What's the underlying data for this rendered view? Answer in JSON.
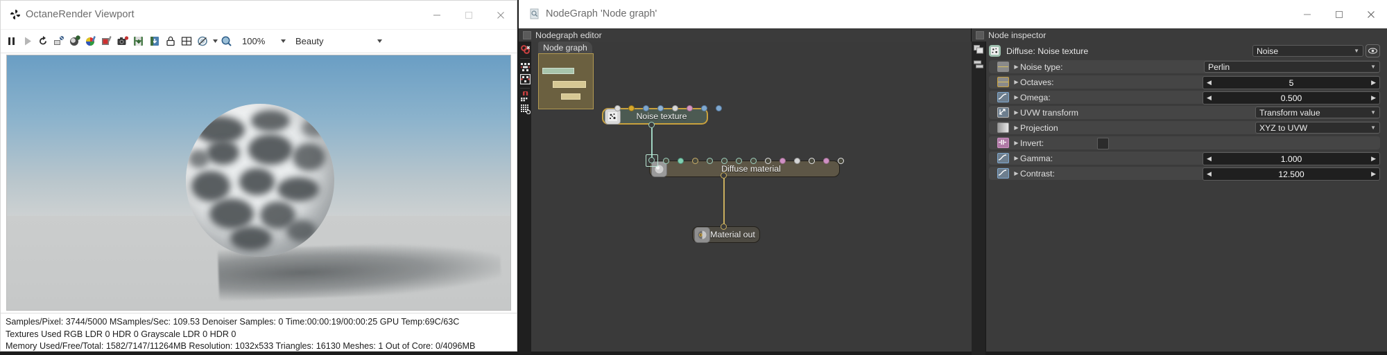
{
  "viewport_window": {
    "title": "OctaneRender Viewport",
    "app_icon": "octane-fan-icon",
    "window_controls": [
      {
        "name": "minimize",
        "glyph": "minimize-icon"
      },
      {
        "name": "maximize",
        "glyph": "maximize-icon"
      },
      {
        "name": "close",
        "glyph": "close-icon"
      }
    ],
    "toolbar": {
      "icons": [
        "pause-icon",
        "play-icon",
        "restart-icon",
        "render-region-icon",
        "render-pass-icon",
        "color-picker-icon",
        "pick-material-icon",
        "camera-focus-icon",
        "save-image-icon",
        "save-render-icon",
        "lock-resolution-icon",
        "grid-layout-icon",
        "eyedropper-disable-icon"
      ],
      "zoom_value": "100%",
      "zoom_options": [
        "100%"
      ],
      "pass_value": "Beauty",
      "pass_options": [
        "Beauty"
      ]
    },
    "status": {
      "line1": "Samples/Pixel: 3744/5000  MSamples/Sec: 109.53  Denoiser Samples: 0  Time:00:00:19/00:00:25  GPU Temp:69C/63C",
      "line2": "Textures Used RGB LDR 0  HDR 0  Grayscale LDR 0  HDR 0",
      "line3": "Memory Used/Free/Total: 1582/7147/11264MB  Resolution: 1032x533  Triangles: 16130  Meshes: 1 Out of Core: 0/4096MB"
    }
  },
  "nodegraph_window": {
    "title": "NodeGraph 'Node graph'",
    "doc_icon": "nodegraph-document-icon",
    "window_controls": [
      {
        "name": "minimize",
        "glyph": "minimize-icon"
      },
      {
        "name": "maximize",
        "glyph": "maximize-icon"
      },
      {
        "name": "close",
        "glyph": "close-icon"
      }
    ],
    "editor": {
      "panel_title": "Nodegraph editor",
      "tab_label": "Node graph",
      "rail_icons": [
        "unlink-nodes-icon",
        "arrange-horizontal-icon",
        "arrange-vertical-icon",
        "snap-to-grid-icon",
        "show-grid-icon"
      ],
      "nodes": [
        {
          "name": "noise-texture-node",
          "label": "Noise texture",
          "icon": "texture-thumbnail-icon",
          "selected": true,
          "body_color": "#4c5a52",
          "outline_color": "#c9a13d",
          "input_sockets": [
            "#dcdcdc",
            "#d7a72a",
            "#7fa8cf",
            "#8fb3d4",
            "#d8d8d8",
            "#d695c2",
            "#7fa8cf",
            "#7fa8cf"
          ],
          "output_socket": "#9fd3c1"
        },
        {
          "name": "diffuse-material-node",
          "label": "Diffuse material",
          "icon": "material-sphere-icon",
          "selected": false,
          "body_color": "#5d5646",
          "outline_color": "#2a2a2a",
          "input_sockets": [
            "#9fd3c1",
            "#7fcfb1",
            "#9fd3c1",
            "#cbb06a",
            "#9fd3c1",
            "#9fd3c1",
            "#9fd3c1",
            "#e8e8e8",
            "#cf90c4",
            "#d4d4d4",
            "#e8e8e8",
            "#cf90c4",
            "#e8e8e8"
          ],
          "output_socket": "#c9ae5e"
        },
        {
          "name": "material-out-node",
          "label": "Material out",
          "icon": "material-out-icon",
          "selected": false,
          "body_color": "#4d4a42",
          "outline_color": "#2a2a2a",
          "output_socket": "#c9ae5e"
        }
      ],
      "connections": [
        {
          "from": "noise-texture-node",
          "to": "diffuse-material-node",
          "color": "#9fd3c1"
        },
        {
          "from": "diffuse-material-node",
          "to": "material-out-node",
          "color": "#c9ae5e"
        }
      ]
    }
  },
  "node_inspector": {
    "panel_title": "Node inspector",
    "rail_icons": [
      "copy-stack-icon",
      "pin-stack-icon"
    ],
    "header": {
      "icon": "texture-thumbnail-icon",
      "label": "Diffuse: Noise texture",
      "value": "Noise",
      "options": [
        "Noise"
      ],
      "eye_icon": "visibility-eye-icon"
    },
    "rows": [
      {
        "name": "noise-type",
        "icon": "gradient-swatch-icon",
        "icon_border": "#8a8a8a",
        "label": "Noise type:",
        "control": "dropdown",
        "value": "Perlin",
        "options": [
          "Perlin"
        ]
      },
      {
        "name": "octaves",
        "icon": "gradient-swatch-icon",
        "icon_border": "#c9a13d",
        "label": "Octaves:",
        "control": "spinner",
        "value": "5"
      },
      {
        "name": "omega",
        "icon": "curve-swatch-icon",
        "icon_border": "#7fa8cf",
        "label": "Omega:",
        "control": "spinner",
        "value": "0.500"
      },
      {
        "name": "uvw-transform",
        "icon": "transform-arrows-icon",
        "icon_border": "#b6b6b6",
        "label": "UVW transform",
        "control": "dropdown",
        "value": "Transform value",
        "options": [
          "Transform value"
        ]
      },
      {
        "name": "projection",
        "icon": "gray-gradient-icon",
        "icon_border": "#8a8a8a",
        "label": "Projection",
        "control": "dropdown",
        "value": "XYZ to UVW",
        "options": [
          "XYZ to UVW"
        ]
      },
      {
        "name": "invert",
        "icon": "invert-swatch-icon",
        "icon_border": "#cf90c4",
        "label": "Invert:",
        "control": "checkbox",
        "value": "false"
      },
      {
        "name": "gamma",
        "icon": "curve-swatch-icon",
        "icon_border": "#7fa8cf",
        "label": "Gamma:",
        "control": "spinner",
        "value": "1.000"
      },
      {
        "name": "contrast",
        "icon": "curve-swatch-icon",
        "icon_border": "#7fa8cf",
        "label": "Contrast:",
        "control": "spinner",
        "value": "12.500"
      }
    ]
  },
  "colors": {
    "window_chrome": "#ffffff",
    "panel_bg": "#2b2b2b",
    "canvas_bg": "#3a3a3a",
    "accent_gold": "#c9a13d",
    "accent_green": "#9fd3c1",
    "minimap_bg": "#6b6040"
  }
}
